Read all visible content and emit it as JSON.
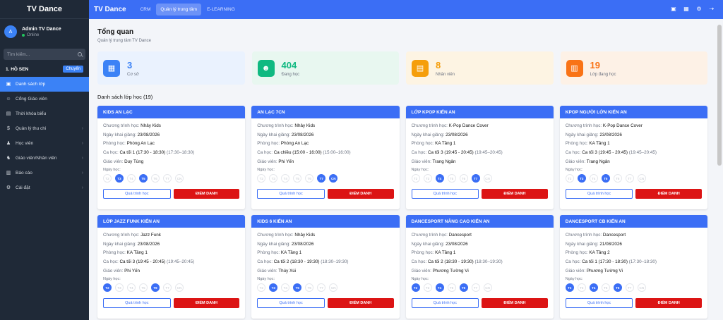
{
  "brand": "TV Dance",
  "user": {
    "avatar": "A",
    "name": "Admin TV Dance",
    "status": "Online"
  },
  "search": {
    "placeholder": "Tìm kiếm..."
  },
  "branch": {
    "name": "1. HỒ SEN",
    "switch_label": "Chuyển"
  },
  "nav": [
    {
      "label": "Danh sách lớp",
      "icon": "grid-icon",
      "active": true,
      "chevron": false
    },
    {
      "label": "Cổng Giáo viên",
      "icon": "user-icon",
      "active": false,
      "chevron": false
    },
    {
      "label": "Thời khóa biểu",
      "icon": "calendar-icon",
      "active": false,
      "chevron": false
    },
    {
      "label": "Quản lý thu chi",
      "icon": "dollar-icon",
      "active": false,
      "chevron": true
    },
    {
      "label": "Học viên",
      "icon": "student-icon",
      "active": false,
      "chevron": true
    },
    {
      "label": "Giáo viên/Nhân viên",
      "icon": "staff-icon",
      "active": false,
      "chevron": true
    },
    {
      "label": "Báo cáo",
      "icon": "report-icon",
      "active": false,
      "chevron": true
    },
    {
      "label": "Cài đặt",
      "icon": "gear-icon",
      "active": false,
      "chevron": true
    }
  ],
  "topbar": {
    "title": "TV Dance",
    "tabs": [
      {
        "label": "CRM",
        "active": false
      },
      {
        "label": "Quản lý trung tâm",
        "active": true
      },
      {
        "label": "E-LEARNING",
        "active": false
      }
    ]
  },
  "page": {
    "title": "Tổng quan",
    "subtitle": "Quản lý trung tâm TV Dance"
  },
  "stats": [
    {
      "value": "3",
      "label": "Cơ sở",
      "color": "#3b82f6",
      "bg": "#eaf2fe",
      "icon": "building-icon"
    },
    {
      "value": "404",
      "label": "Đang học",
      "color": "#10b981",
      "bg": "#e8f7f0",
      "icon": "users-icon"
    },
    {
      "value": "8",
      "label": "Nhân viên",
      "color": "#f59e0b",
      "bg": "#fdf4e3",
      "icon": "briefcase-icon"
    },
    {
      "value": "19",
      "label": "Lớp đang học",
      "color": "#f97316",
      "bg": "#fdf1e6",
      "icon": "book-icon"
    }
  ],
  "list_title": "Danh sách lớp học (19)",
  "labels": {
    "program": "Chương trình học:",
    "start": "Ngày khai giảng:",
    "room": "Phòng học:",
    "shift": "Ca học:",
    "teacher": "Giáo viên:",
    "days": "Ngày học:",
    "progress_btn": "Quá trình học",
    "checkin_btn": "ĐIỂM DANH"
  },
  "day_names": [
    "T2",
    "T3",
    "T4",
    "T5",
    "T6",
    "T7",
    "CN"
  ],
  "classes": [
    {
      "name": "KIDS AN LẠC",
      "program": "Nhảy Kids",
      "start": "23/08/2026",
      "room": "Phòng An Lạc",
      "shift": "Ca tối 1 (17:30 - 18:30)",
      "shift_time": "(17:30–18:30)",
      "teacher": "Duy Tùng",
      "days": [
        false,
        true,
        false,
        true,
        false,
        false,
        false
      ]
    },
    {
      "name": "AN LẠC 7CN",
      "program": "Nhảy Kids",
      "start": "23/08/2026",
      "room": "Phòng An Lạc",
      "shift": "Ca chiều (15:00 - 16:00)",
      "shift_time": "(15:00–16:00)",
      "teacher": "Phi Yến",
      "days": [
        false,
        false,
        false,
        false,
        false,
        true,
        true
      ]
    },
    {
      "name": "LỚP KPOP KIẾN AN",
      "program": "K-Pop Dance Cover",
      "start": "23/08/2026",
      "room": "KA Tầng 1",
      "shift": "Ca tối 3 (19:45 - 20:45)",
      "shift_time": "(19:45–20:45)",
      "teacher": "Trang Ngân",
      "days": [
        false,
        false,
        true,
        false,
        false,
        true,
        false
      ]
    },
    {
      "name": "KPOP NGƯỜI LỚN KIẾN AN",
      "program": "K-Pop Dance Cover",
      "start": "23/08/2026",
      "room": "KA Tầng 1",
      "shift": "Ca tối 3 (19:45 - 20:45)",
      "shift_time": "(19:45–20:45)",
      "teacher": "Trang Ngân",
      "days": [
        false,
        true,
        false,
        true,
        false,
        false,
        false
      ]
    },
    {
      "name": "LỚP JAZZ FUNK KIẾN AN",
      "program": "Jazz Funk",
      "start": "23/08/2026",
      "room": "KA Tầng 1",
      "shift": "Ca tối 3 (19:45 - 20:45)",
      "shift_time": "(19:45–20:45)",
      "teacher": "Phi Yến",
      "days": [
        true,
        false,
        false,
        false,
        true,
        false,
        false
      ]
    },
    {
      "name": "KIDS 6 KIẾN AN",
      "program": "Nhảy Kids",
      "start": "23/08/2026",
      "room": "KA Tầng 1",
      "shift": "Ca tối 2 (18:30 - 19:30)",
      "shift_time": "(18:30–19:30)",
      "teacher": "Thúy Xúi",
      "days": [
        false,
        true,
        false,
        true,
        false,
        false,
        false
      ]
    },
    {
      "name": "DANCESPORT NÂNG CAO KIẾN AN",
      "program": "Dancesport",
      "start": "23/08/2026",
      "room": "KA Tầng 1",
      "shift": "Ca tối 2 (18:30 - 19:30)",
      "shift_time": "(18:30–19:30)",
      "teacher": "Phương Tường Vi",
      "days": [
        true,
        false,
        true,
        false,
        true,
        false,
        false
      ]
    },
    {
      "name": "DANCESPORT CB KIẾN AN",
      "program": "Dancesport",
      "start": "21/08/2026",
      "room": "KA Tầng 2",
      "shift": "Ca tối 1 (17:30 - 18:30)",
      "shift_time": "(17:30–18:30)",
      "teacher": "Phương Tường Vi",
      "days": [
        true,
        false,
        true,
        false,
        true,
        false,
        false
      ]
    }
  ]
}
